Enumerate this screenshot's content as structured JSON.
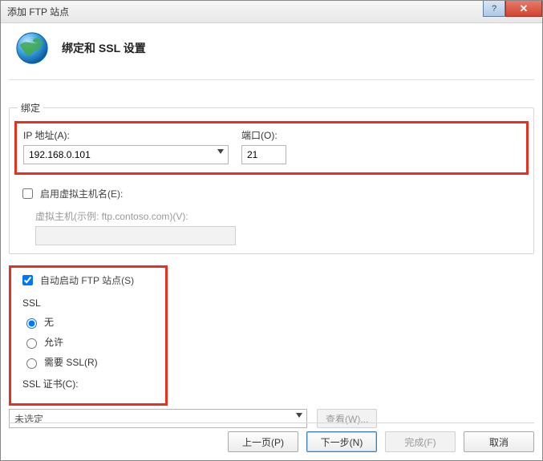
{
  "window": {
    "title": "添加 FTP 站点"
  },
  "header": {
    "title": "绑定和 SSL 设置"
  },
  "binding": {
    "legend": "绑定",
    "ip_label": "IP 地址(A):",
    "ip_value": "192.168.0.101",
    "port_label": "端口(O):",
    "port_value": "21",
    "vhost_enable_label": "启用虚拟主机名(E):",
    "vhost_enable_checked": false,
    "vhost_hint": "虚拟主机(示例: ftp.contoso.com)(V):"
  },
  "autostart": {
    "label": "自动启动 FTP 站点(S)",
    "checked": true
  },
  "ssl": {
    "legend": "SSL",
    "options": {
      "none": "无",
      "allow": "允许",
      "require": "需要 SSL(R)"
    },
    "selected": "none",
    "cert_label": "SSL 证书(C):",
    "cert_value": "未选定",
    "view_button": "查看(W)..."
  },
  "footer": {
    "prev": "上一页(P)",
    "next": "下一步(N)",
    "finish": "完成(F)",
    "cancel": "取消"
  }
}
